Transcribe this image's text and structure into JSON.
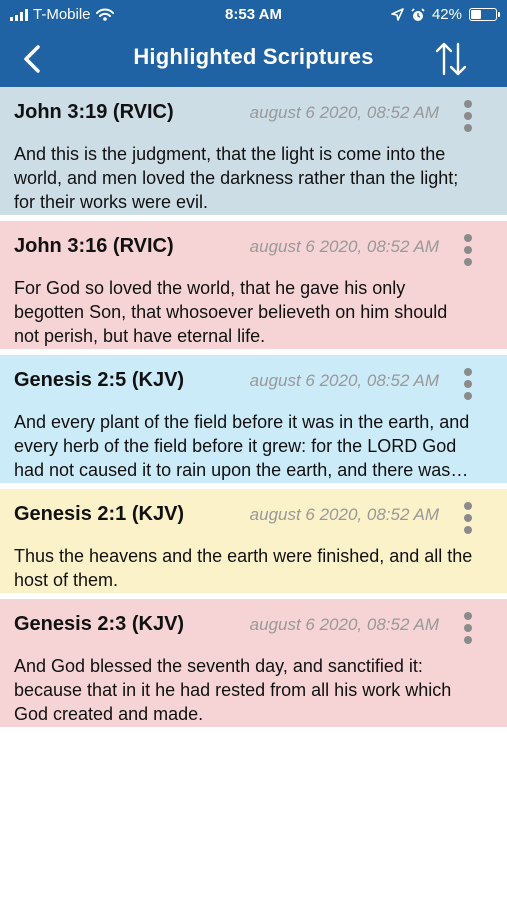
{
  "status_bar": {
    "carrier": "T-Mobile",
    "time": "8:53 AM",
    "battery_percent": "42%",
    "battery_level": 0.42
  },
  "header": {
    "title": "Highlighted Scriptures",
    "back_icon": "chevron-left-icon",
    "sort_icon": "sort-arrows-icon"
  },
  "colors": {
    "header": "#1f63a5",
    "blue_gray": "#ccdde6",
    "pink": "#f6d4d5",
    "light_blue": "#ccebf9",
    "yellow": "#fbf2c9"
  },
  "highlights": [
    {
      "reference": "John 3:19 (RVIC)",
      "date": "august 6 2020, 08:52 AM",
      "text": "And this is the judgment, that the light is come into the world, and men loved the darkness rather than the light; for their works were evil.",
      "color": "#ccdde6"
    },
    {
      "reference": "John 3:16 (RVIC)",
      "date": "august 6 2020, 08:52 AM",
      "text": "For God so loved the world, that he gave his only begotten Son, that whosoever believeth on him should not perish, but have eternal life.",
      "color": "#f6d4d5"
    },
    {
      "reference": "Genesis 2:5 (KJV)",
      "date": "august 6 2020, 08:52 AM",
      "text": "And every plant of the field before it was in the earth, and every herb of the field before it grew: for the LORD God had not caused it to rain upon the earth, and there was not a man to till the ground.",
      "color": "#ccebf9"
    },
    {
      "reference": "Genesis 2:1 (KJV)",
      "date": "august 6 2020, 08:52 AM",
      "text": "Thus the heavens and the earth were finished, and all the host of them.",
      "color": "#fbf2c9"
    },
    {
      "reference": "Genesis 2:3 (KJV)",
      "date": "august 6 2020, 08:52 AM",
      "text": "And God blessed the seventh day, and sanctified it: because that in it he had rested from all his work which God created and made.",
      "color": "#f6d4d5"
    }
  ]
}
